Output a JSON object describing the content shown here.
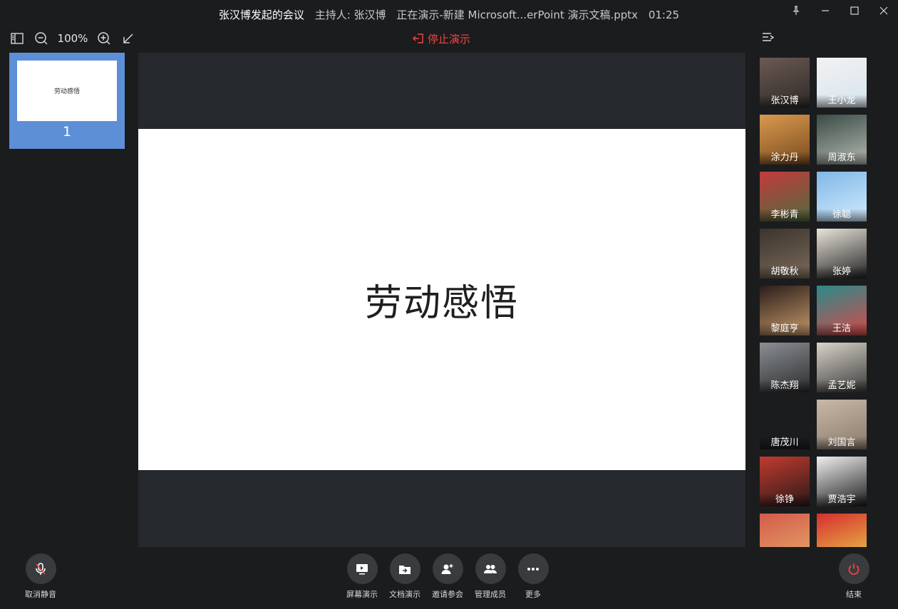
{
  "titlebar": {
    "meeting_title": "张汉博发起的会议",
    "host": "主持人: 张汉博",
    "presenting": "正在演示-新建 Microsoft...erPoint 演示文稿.pptx",
    "timer": "01:25",
    "pin_icon": "pin-icon",
    "minimize_icon": "minimize-icon",
    "maximize_icon": "maximize-icon",
    "close_icon": "close-icon"
  },
  "toolbar": {
    "zoom_level": "100%",
    "stop_presenting": "停止演示"
  },
  "thumbnails": [
    {
      "title": "劳动感悟",
      "number": "1"
    }
  ],
  "slide": {
    "title": "劳动感悟"
  },
  "participants": [
    {
      "name": "张汉博",
      "colors": [
        "#6b5a52",
        "#2d2a28"
      ]
    },
    {
      "name": "王小龙",
      "colors": [
        "#f2f2f2",
        "#d7e4ee"
      ]
    },
    {
      "name": "涂力丹",
      "colors": [
        "#d99a4e",
        "#7a4a1e"
      ]
    },
    {
      "name": "周淑东",
      "colors": [
        "#3a4b46",
        "#b4b9b0"
      ]
    },
    {
      "name": "李彬青",
      "colors": [
        "#c23b3b",
        "#4f6b3e"
      ]
    },
    {
      "name": "徐聪",
      "colors": [
        "#7fb7e6",
        "#d3ecff"
      ]
    },
    {
      "name": "胡敬秋",
      "colors": [
        "#3b342e",
        "#7d6b5a"
      ]
    },
    {
      "name": "张婷",
      "colors": [
        "#e9e4da",
        "#222222"
      ]
    },
    {
      "name": "黎庭亨",
      "colors": [
        "#2a1e1a",
        "#c89a6a"
      ]
    },
    {
      "name": "王洁",
      "colors": [
        "#2a8a8a",
        "#d64a4a"
      ]
    },
    {
      "name": "陈杰翔",
      "colors": [
        "#8a8f94",
        "#2c2c2c"
      ]
    },
    {
      "name": "孟艺妮",
      "colors": [
        "#d9d4c9",
        "#3a3a3a"
      ]
    },
    {
      "name": "唐茂川",
      "colors": [
        "#1b1c1e",
        "#1b1c1e"
      ]
    },
    {
      "name": "刘国言",
      "colors": [
        "#c9b9a8",
        "#8a7a6a"
      ]
    },
    {
      "name": "徐铮",
      "colors": [
        "#c23a2e",
        "#2a1a18"
      ]
    },
    {
      "name": "贾浩宇",
      "colors": [
        "#f0f0f0",
        "#1a1a1a"
      ]
    },
    {
      "name": "",
      "colors": [
        "#d45a4a",
        "#e5a86a"
      ]
    },
    {
      "name": "",
      "colors": [
        "#d62e2e",
        "#e8c84a"
      ]
    }
  ],
  "bottom": {
    "unmute": "取消静音",
    "screen_share": "屏幕演示",
    "doc_present": "文档演示",
    "invite": "邀请参会",
    "manage": "管理成员",
    "more": "更多",
    "end": "结束"
  },
  "colors": {
    "background": "#1b1c1e",
    "stage": "#25282d",
    "accent_red": "#f04545",
    "thumb_selected": "#5d8fd6"
  }
}
